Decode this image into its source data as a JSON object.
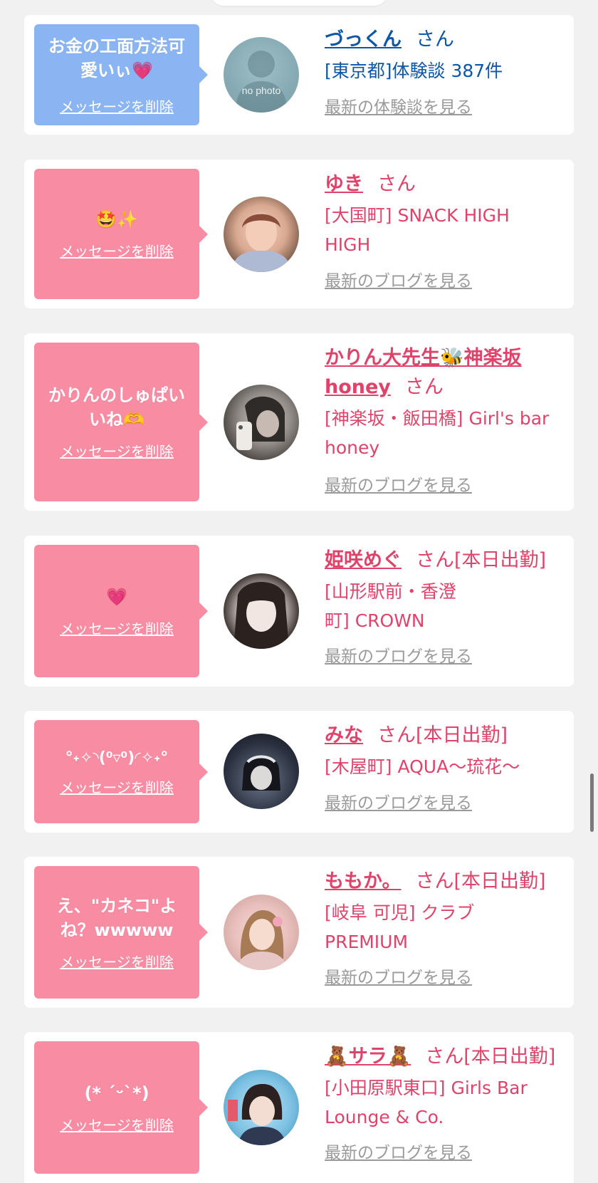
{
  "delete_label": "メッセージを削除",
  "honorific": "さん",
  "colors": {
    "pink": "#f78ca3",
    "blue": "#8bb4f2",
    "name_pink": "#e0436a",
    "name_blue": "#0e56a6",
    "link_gray": "#9a9a9a"
  },
  "cards": [
    {
      "message": "お金の工面方法可\n愛いぃ💗",
      "name": "づっくん",
      "status": "",
      "shop": "[東京都]体験談 387件",
      "link": "最新の体験談を見る",
      "avatar": "no photo"
    },
    {
      "message": "🤩✨",
      "name": "ゆき",
      "status": "",
      "shop": "[大国町] SNACK HIGH HIGH",
      "link": "最新のブログを見る",
      "avatar": ""
    },
    {
      "message": "かりんのしゅぱい\nいね🫶",
      "name": "かりん大先生🐝神楽坂honey",
      "status": "",
      "shop": "[神楽坂・飯田橋] Girl's bar honey",
      "link": "最新のブログを見る",
      "avatar": ""
    },
    {
      "message": "💗",
      "name": "姫咲めぐ",
      "status": "[本日出勤]",
      "shop": "[山形駅前・香澄町] CROWN",
      "link": "最新のブログを見る",
      "avatar": ""
    },
    {
      "message": "°˖✧◝(⁰▿⁰)◜✧˖°",
      "name": "みな",
      "status": "[本日出勤]",
      "shop": "[木屋町] AQUA〜琉花〜",
      "link": "最新のブログを見る",
      "avatar": ""
    },
    {
      "message": "え、\"カネコ\"よ\nね？wwwww",
      "name": "ももか。",
      "status": "[本日出勤]",
      "shop": "[岐阜 可児] クラブ PREMIUM",
      "link": "最新のブログを見る",
      "avatar": ""
    },
    {
      "message": "(* ˊᵕˋ*)",
      "name": "🧸サラ🧸",
      "status": "[本日出勤]",
      "shop": "[小田原駅東口] Girls Bar Lounge & Co.",
      "link": "最新のブログを見る",
      "avatar": ""
    }
  ]
}
